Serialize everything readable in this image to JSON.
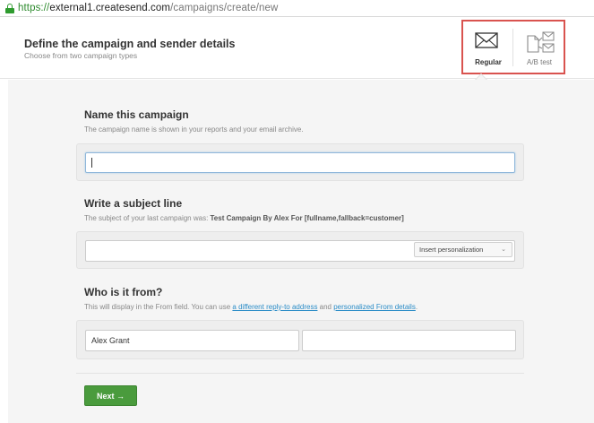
{
  "browser": {
    "url_scheme": "https://",
    "url_host": "external1.createsend.com",
    "url_path": "/campaigns/create/new"
  },
  "header": {
    "title": "Define the campaign and sender details",
    "subtitle": "Choose from two campaign types",
    "types": [
      {
        "label": "Regular",
        "icon": "envelope-icon",
        "selected": true
      },
      {
        "label": "A/B test",
        "icon": "ab-test-icon",
        "selected": false
      }
    ],
    "highlight_color": "#d9534f"
  },
  "name_section": {
    "title": "Name this campaign",
    "description": "The campaign name is shown in your reports and your email archive.",
    "input_value": ""
  },
  "subject_section": {
    "title": "Write a subject line",
    "description_prefix": "The subject of your last campaign was: ",
    "last_subject": "Test Campaign By Alex For [fullname,fallback=customer]",
    "input_value": "",
    "personalization_label": "Insert personalization"
  },
  "from_section": {
    "title": "Who is it from?",
    "description_prefix": "This will display in the From field. You can use ",
    "link_reply_to": "a different reply-to address",
    "description_middle": " and ",
    "link_personalized": "personalized From details",
    "description_suffix": ".",
    "from_name_value": "Alex Grant",
    "from_email_value": ""
  },
  "actions": {
    "next_label": "Next →",
    "next_color": "#4a9b3d"
  }
}
